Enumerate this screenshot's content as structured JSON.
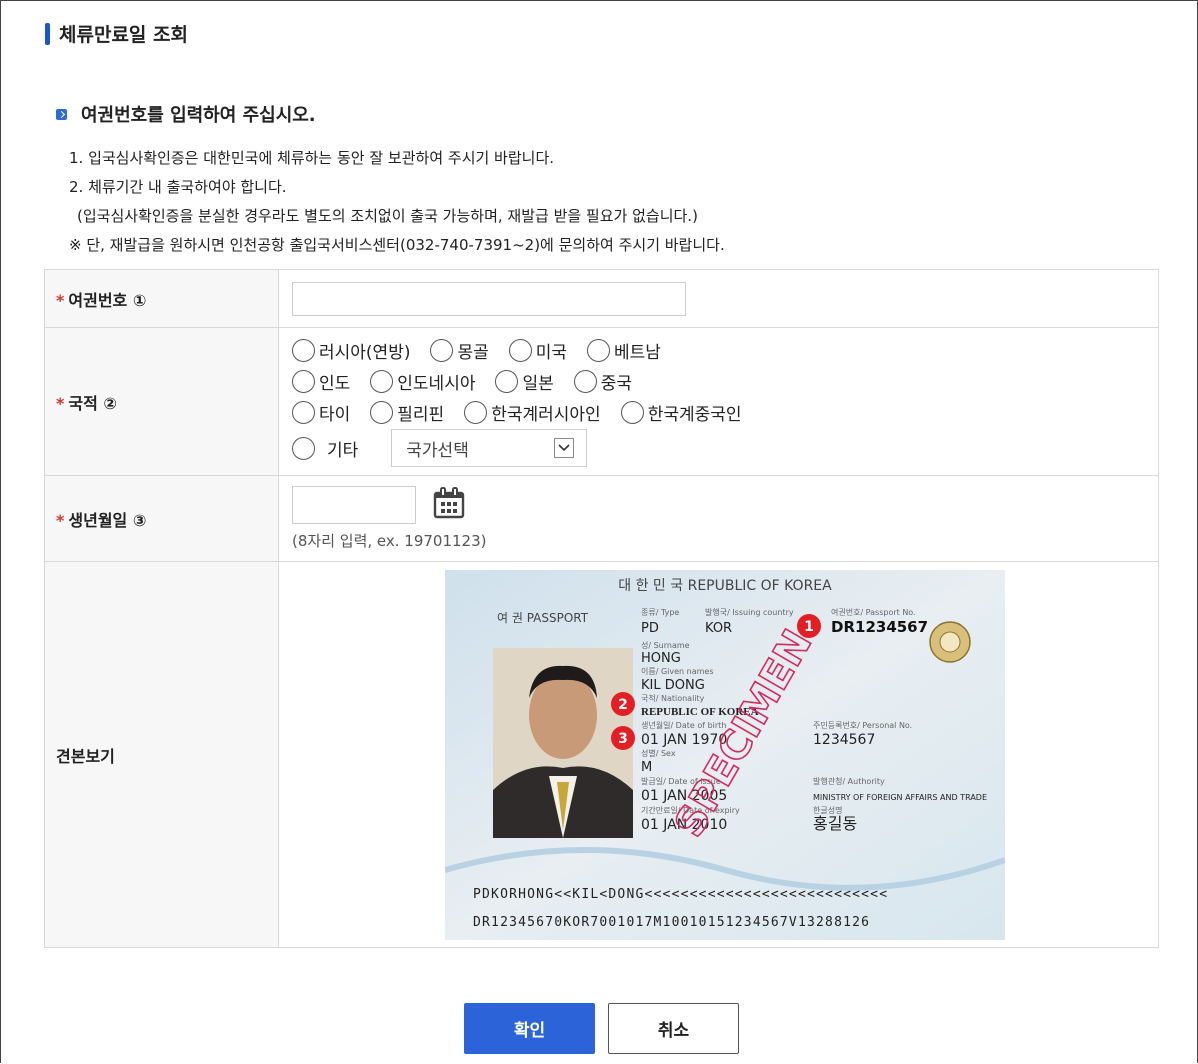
{
  "page": {
    "title": "체류만료일 조회",
    "section_title": "여권번호를 입력하여 주십시오.",
    "notes": [
      "1. 입국심사확인증은 대한민국에 체류하는 동안 잘 보관하여 주시기 바랍니다.",
      "2. 체류기간 내 출국하여야 합니다.",
      "(입국심사확인증을 분실한 경우라도 별도의 조치없이 출국 가능하며, 재발급 받을 필요가 없습니다.)",
      "※ 단, 재발급을 원하시면 인천공항 출입국서비스센터(032-740-7391~2)에 문의하여 주시기 바랍니다."
    ]
  },
  "form": {
    "required_mark": "*",
    "passport_label": "여권번호 ①",
    "passport_value": "",
    "nationality_label": "국적 ②",
    "nationality_rows": [
      [
        "러시아(연방)",
        "몽골",
        "미국",
        "베트남"
      ],
      [
        "인도",
        "인도네시아",
        "일본",
        "중국"
      ],
      [
        "타이",
        "필리핀",
        "한국계러시아인",
        "한국계중국인"
      ]
    ],
    "other_label": "기타",
    "country_select": "국가선택",
    "birth_label": "생년월일 ③",
    "birth_value": "",
    "birth_hint": "(8자리 입력, ex. 19701123)",
    "sample_label": "견본보기"
  },
  "passport_sample": {
    "header": "대 한 민 국   REPUBLIC OF KOREA",
    "doc_label": "여 권  PASSPORT",
    "type_caption": "종류/ Type",
    "type": "PD",
    "country_caption": "발행국/ Issuing country",
    "country": "KOR",
    "no_caption": "여권번호/ Passport No.",
    "passport_no": "DR1234567",
    "surname_caption": "성/ Surname",
    "surname": "HONG",
    "given_caption": "이름/ Given names",
    "given_names": "KIL DONG",
    "nationality_caption": "국적/ Nationality",
    "nationality": "REPUBLIC OF KOREA",
    "dob_caption": "생년월일/ Date of birth",
    "dob": "01 JAN 1970",
    "personal_caption": "주민등록번호/ Personal No.",
    "personal_no": "1234567",
    "sex_caption": "성별/ Sex",
    "sex": "M",
    "issue_caption": "발급일/ Date of issue",
    "issue_date": "01 JAN 2005",
    "authority_caption": "발행관청/ Authority",
    "authority": "MINISTRY OF FOREIGN AFFAIRS AND TRADE",
    "expiry_caption": "기간만료일/ Date of expiry",
    "expiry_date": "01 JAN 2010",
    "signature_caption": "한글성명",
    "signature": "홍길동",
    "watermark": "SPECIMEN",
    "mrz1": "PDKORHONG<<KIL<DONG<<<<<<<<<<<<<<<<<<<<<<<<<<<",
    "mrz2": "DR12345670KOR7001017M10010151234567V13288126",
    "markers": [
      "1",
      "2",
      "3"
    ]
  },
  "buttons": {
    "confirm": "확인",
    "cancel": "취소"
  },
  "colors": {
    "accent": "#2c63d8",
    "required": "#e03232",
    "marker": "#e31e24"
  }
}
